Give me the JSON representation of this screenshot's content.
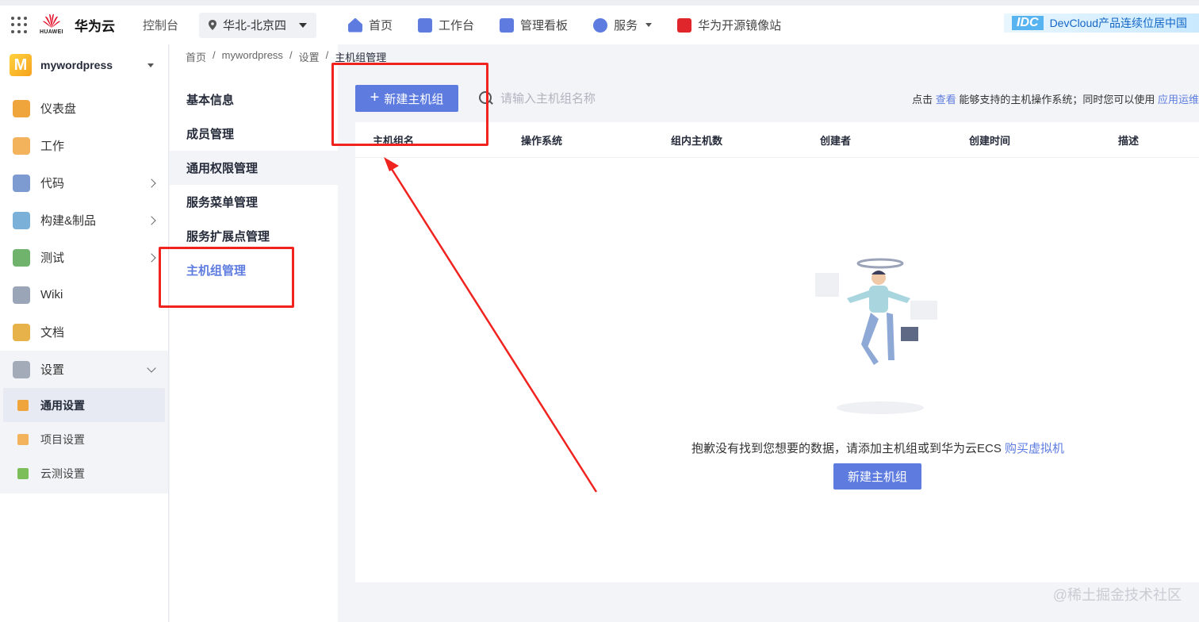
{
  "topbar": {
    "brand_small": "HUAWEI",
    "brand": "华为云",
    "console": "控制台",
    "region": "华北-北京四",
    "nav": [
      {
        "label": "首页",
        "icon": "home-icon",
        "color": "#5e7ce0"
      },
      {
        "label": "工作台",
        "icon": "workbench-icon",
        "color": "#5e7ce0"
      },
      {
        "label": "管理看板",
        "icon": "dashboard-board-icon",
        "color": "#5e7ce0"
      },
      {
        "label": "服务",
        "icon": "service-icon",
        "color": "#5e7ce0"
      },
      {
        "label": "华为开源镜像站",
        "icon": "mirror-site-icon",
        "color": "#e0262a"
      }
    ],
    "banner_badge": "IDC",
    "banner_text": "DevCloud产品连续位居中国"
  },
  "sidebar": {
    "project_initial": "M",
    "project_name": "mywordpress",
    "items": [
      {
        "label": "仪表盘",
        "icon": "dashboard-icon",
        "color": "#f0a43c"
      },
      {
        "label": "工作",
        "icon": "work-icon",
        "color": "#f2b35c"
      },
      {
        "label": "代码",
        "icon": "code-icon",
        "color": "#7d9bd1"
      },
      {
        "label": "构建&制品",
        "icon": "build-icon",
        "color": "#7bb1d9"
      },
      {
        "label": "测试",
        "icon": "test-icon",
        "color": "#6fb36c"
      },
      {
        "label": "Wiki",
        "icon": "wiki-icon",
        "color": "#9aa5b8"
      },
      {
        "label": "文档",
        "icon": "docs-icon",
        "color": "#e8b24a"
      }
    ],
    "settings_label": "设置",
    "settings_sub": [
      {
        "label": "通用设置",
        "icon": "general-settings-icon",
        "color": "#f0a43c"
      },
      {
        "label": "项目设置",
        "icon": "project-settings-icon",
        "color": "#f2b35c"
      },
      {
        "label": "云测设置",
        "icon": "cloudtest-settings-icon",
        "color": "#7cbf5a"
      }
    ]
  },
  "breadcrumb": {
    "items": [
      "首页",
      "mywordpress",
      "设置"
    ],
    "current": "主机组管理",
    "sep": "/"
  },
  "subnav": {
    "items": [
      "基本信息",
      "成员管理",
      "通用权限管理",
      "服务菜单管理",
      "服务扩展点管理",
      "主机组管理"
    ]
  },
  "toolbar": {
    "new_button": "新建主机组",
    "search_placeholder": "请输入主机组名称",
    "hint_prefix": "点击",
    "hint_link1": "查看",
    "hint_mid": "能够支持的主机操作系统；同时您可以使用",
    "hint_link2": "应用运维"
  },
  "table": {
    "headers": [
      "主机组名",
      "操作系统",
      "组内主机数",
      "创建者",
      "创建时间",
      "描述"
    ]
  },
  "empty": {
    "message": "抱歉没有找到您想要的数据，请添加主机组或到华为云ECS",
    "link": "购买虚拟机",
    "button": "新建主机组"
  },
  "watermark": "@稀土掘金技术社区",
  "colors": {
    "primary": "#5e7ce0",
    "annotation": "#f0231f"
  }
}
